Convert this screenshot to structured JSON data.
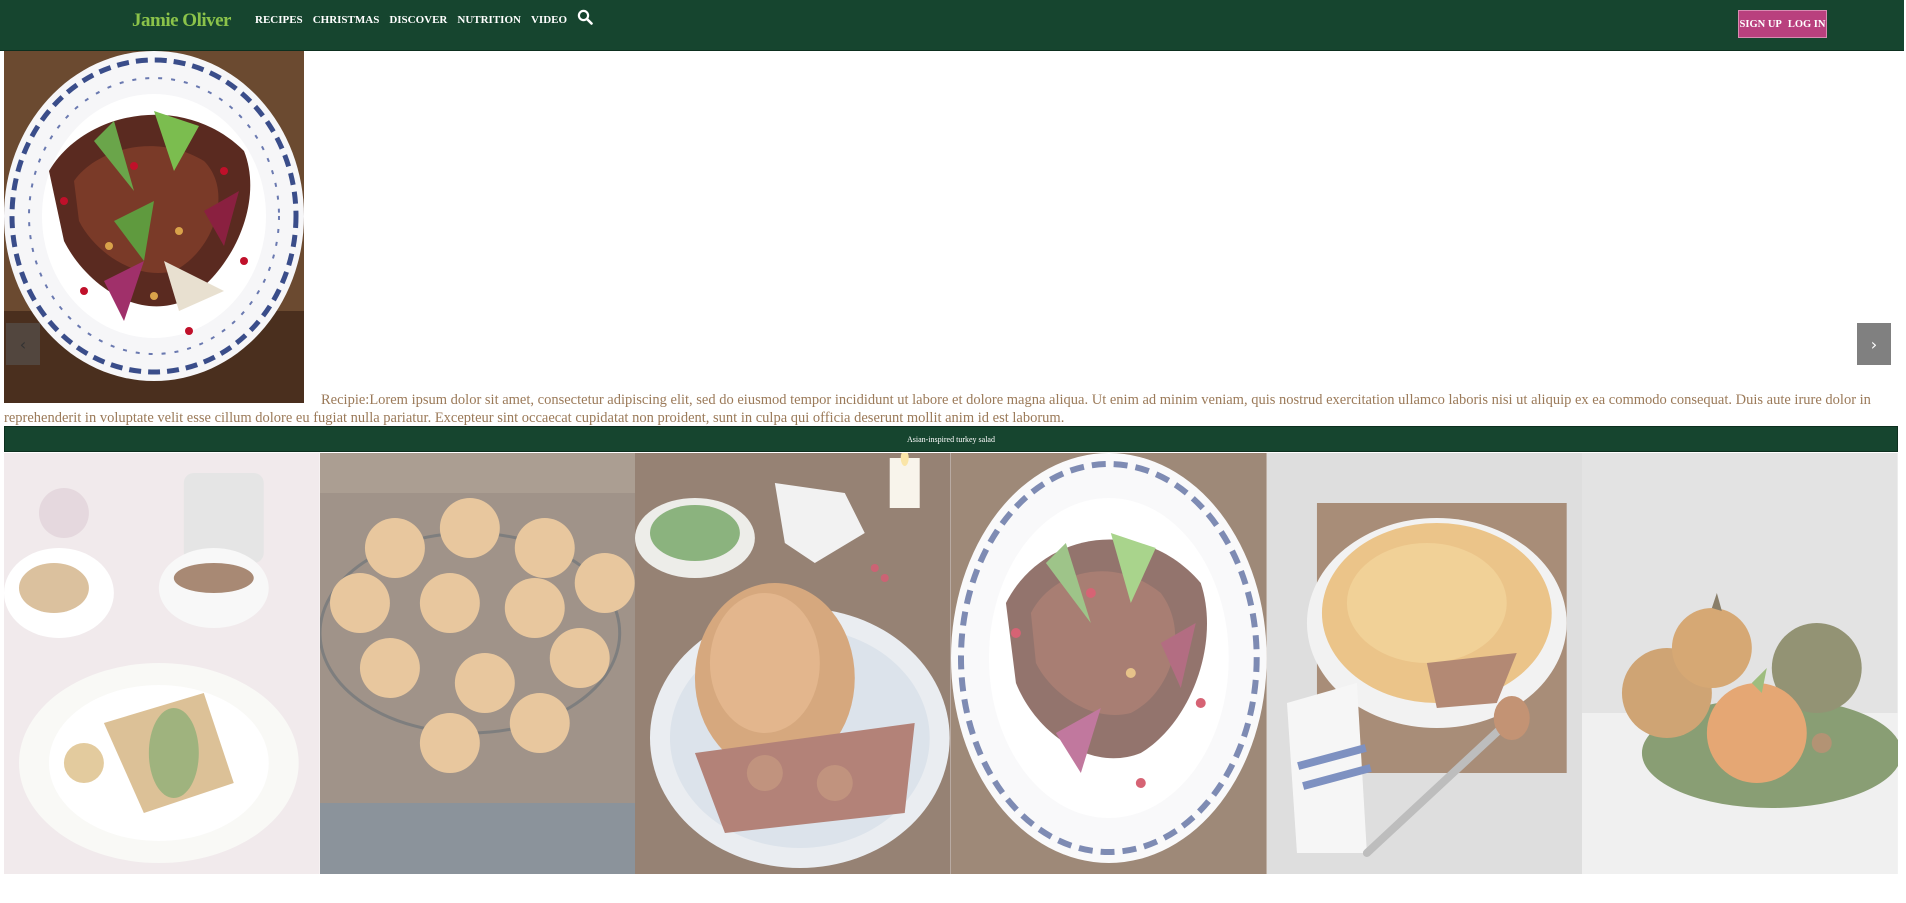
{
  "header": {
    "logo": "Jamie Oliver",
    "nav": [
      "RECIPES",
      "CHRISTMAS",
      "DISCOVER",
      "NUTRITION",
      "VIDEO"
    ],
    "signup_label": "SIGN UP",
    "login_label": "LOG IN"
  },
  "carousel": {
    "prev_label": "‹",
    "next_label": "›",
    "description": "Recipie:Lorem ipsum dolor sit amet, consectetur adipiscing elit, sed do eiusmod tempor incididunt ut labore et dolore magna aliqua. Ut enim ad minim veniam, quis nostrud exercitation ullamco laboris nisi ut aliquip ex ea commodo consequat. Duis aute irure dolor in reprehenderit in voluptate velit esse cillum dolore eu fugiat nulla pariatur. Excepteur sint occaecat cupidatat non proident, sunt in culpa qui officia deserunt mollit anim id est laborum.",
    "caption": "Asian-inspired turkey salad"
  },
  "colors": {
    "header_bg": "#16452f",
    "auth_button": "#b9407e",
    "description_text": "#9b7a59"
  }
}
